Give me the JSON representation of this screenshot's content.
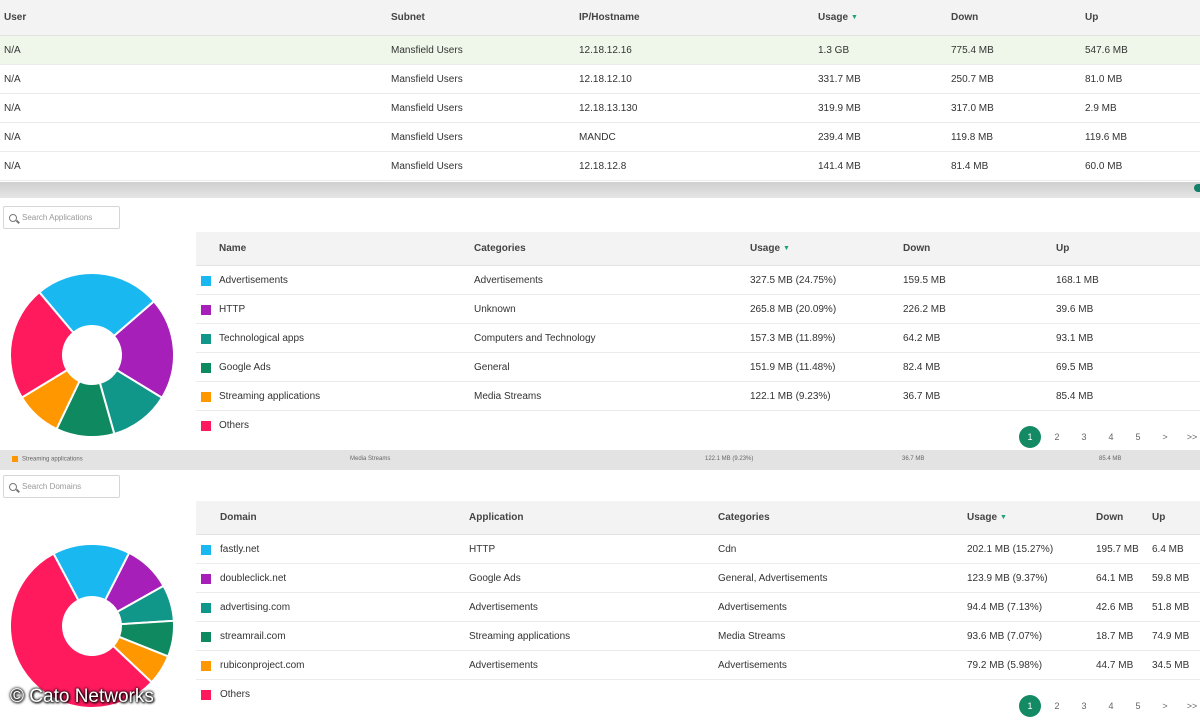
{
  "users_table": {
    "headers": {
      "user": "User",
      "subnet": "Subnet",
      "ip": "IP/Hostname",
      "usage": "Usage",
      "down": "Down",
      "up": "Up"
    },
    "rows": [
      {
        "user": "N/A",
        "subnet": "Mansfield Users",
        "ip": "12.18.12.16",
        "usage": "1.3 GB",
        "down": "775.4 MB",
        "up": "547.6 MB"
      },
      {
        "user": "N/A",
        "subnet": "Mansfield Users",
        "ip": "12.18.12.10",
        "usage": "331.7 MB",
        "down": "250.7 MB",
        "up": "81.0 MB"
      },
      {
        "user": "N/A",
        "subnet": "Mansfield Users",
        "ip": "12.18.13.130",
        "usage": "319.9 MB",
        "down": "317.0 MB",
        "up": "2.9 MB"
      },
      {
        "user": "N/A",
        "subnet": "Mansfield Users",
        "ip": "MANDC",
        "usage": "239.4 MB",
        "down": "119.8 MB",
        "up": "119.6 MB"
      },
      {
        "user": "N/A",
        "subnet": "Mansfield Users",
        "ip": "12.18.12.8",
        "usage": "141.4 MB",
        "down": "81.4 MB",
        "up": "60.0 MB"
      }
    ]
  },
  "applications": {
    "search_placeholder": "Search Applications",
    "headers": {
      "name": "Name",
      "categories": "Categories",
      "usage": "Usage",
      "down": "Down",
      "up": "Up"
    },
    "rows": [
      {
        "name": "Advertisements",
        "category": "Advertisements",
        "usage": "327.5 MB (24.75%)",
        "down": "159.5 MB",
        "up": "168.1 MB"
      },
      {
        "name": "HTTP",
        "category": "Unknown",
        "usage": "265.8 MB (20.09%)",
        "down": "226.2 MB",
        "up": "39.6 MB"
      },
      {
        "name": "Technological apps",
        "category": "Computers and Technology",
        "usage": "157.3 MB (11.89%)",
        "down": "64.2 MB",
        "up": "93.1 MB"
      },
      {
        "name": "Google Ads",
        "category": "General",
        "usage": "151.9 MB (11.48%)",
        "down": "82.4 MB",
        "up": "69.5 MB"
      },
      {
        "name": "Streaming applications",
        "category": "Media Streams",
        "usage": "122.1 MB (9.23%)",
        "down": "36.7 MB",
        "up": "85.4 MB"
      },
      {
        "name": "Others",
        "category": "",
        "usage": "",
        "down": "",
        "up": ""
      }
    ],
    "pager": [
      "1",
      "2",
      "3",
      "4",
      "5",
      ">",
      ">>"
    ],
    "active_page": "1"
  },
  "ghost_row": {
    "name": "Streaming applications",
    "category": "Media Streams",
    "usage": "122.1 MB (9.23%)",
    "down": "36.7 MB",
    "up": "85.4 MB"
  },
  "domains": {
    "search_placeholder": "Search Domains",
    "headers": {
      "domain": "Domain",
      "application": "Application",
      "categories": "Categories",
      "usage": "Usage",
      "down": "Down",
      "up": "Up"
    },
    "rows": [
      {
        "domain": "fastly.net",
        "application": "HTTP",
        "category": "Cdn",
        "usage": "202.1 MB (15.27%)",
        "down": "195.7 MB",
        "up": "6.4 MB"
      },
      {
        "domain": "doubleclick.net",
        "application": "Google Ads",
        "category": "General, Advertisements",
        "usage": "123.9 MB (9.37%)",
        "down": "64.1 MB",
        "up": "59.8 MB"
      },
      {
        "domain": "advertising.com",
        "application": "Advertisements",
        "category": "Advertisements",
        "usage": "94.4 MB (7.13%)",
        "down": "42.6 MB",
        "up": "51.8 MB"
      },
      {
        "domain": "streamrail.com",
        "application": "Streaming applications",
        "category": "Media Streams",
        "usage": "93.6 MB (7.07%)",
        "down": "18.7 MB",
        "up": "74.9 MB"
      },
      {
        "domain": "rubiconproject.com",
        "application": "Advertisements",
        "category": "Advertisements",
        "usage": "79.2 MB (5.98%)",
        "down": "44.7 MB",
        "up": "34.5 MB"
      },
      {
        "domain": "Others",
        "application": "",
        "category": "",
        "usage": "",
        "down": "",
        "up": ""
      }
    ],
    "pager": [
      "1",
      "2",
      "3",
      "4",
      "5",
      ">",
      ">>"
    ],
    "active_page": "1"
  },
  "colors": {
    "accent": "#138a63",
    "selected_row": "#eef7e9",
    "series": [
      "#1ab8f0",
      "#a51fb8",
      "#11968a",
      "#0f8a60",
      "#ff9800",
      "#ff1a5e"
    ]
  },
  "app_pie": {
    "shares": [
      24.75,
      20.09,
      11.89,
      11.48,
      9.23,
      22.56
    ]
  },
  "domain_pie": {
    "shares": [
      15.27,
      9.37,
      7.13,
      7.07,
      5.98,
      55.18
    ]
  },
  "watermark": "© Cato Networks"
}
